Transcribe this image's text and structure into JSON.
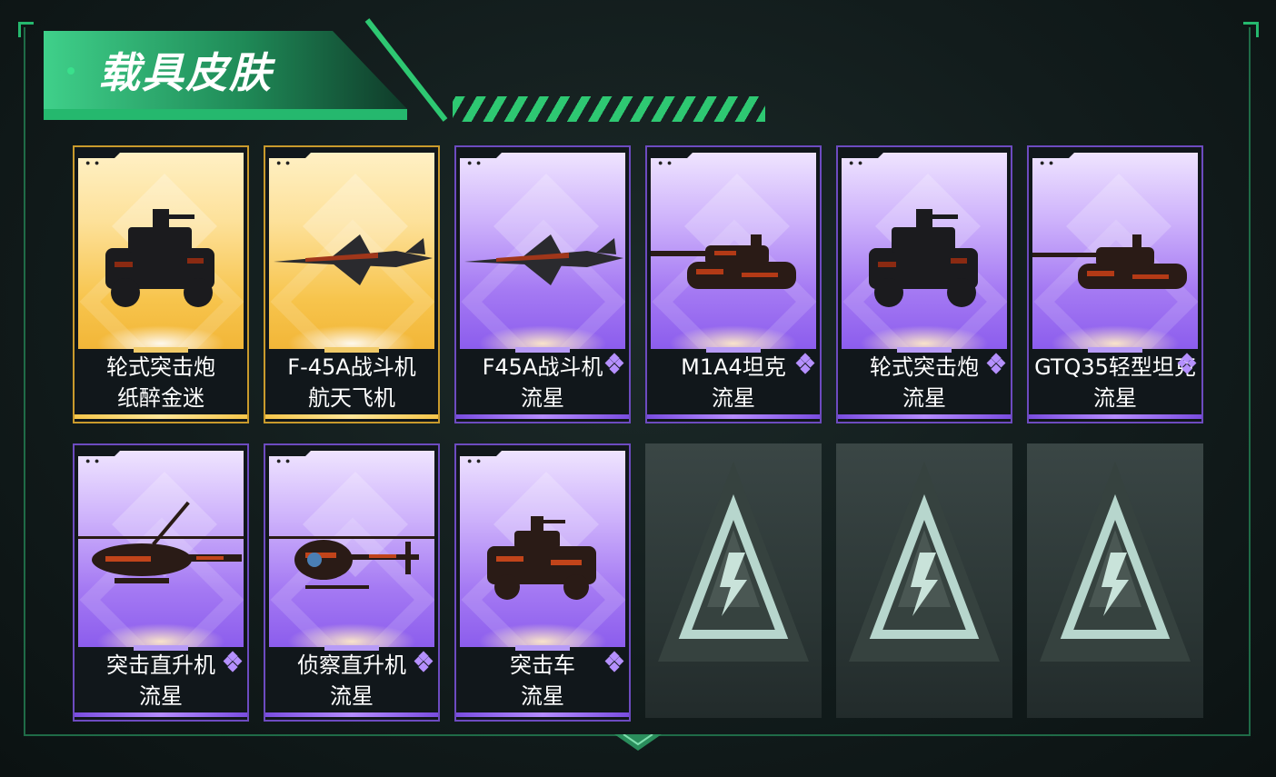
{
  "header": {
    "title": "载具皮肤"
  },
  "cards": [
    {
      "name": "轮式突击炮",
      "skin": "纸醉金迷",
      "rarity": "gold",
      "vehicle_icon": "armored-car-icon"
    },
    {
      "name": "F-45A战斗机",
      "skin": "航天飞机",
      "rarity": "gold",
      "vehicle_icon": "fighter-jet-icon"
    },
    {
      "name": "F45A战斗机",
      "skin": "流星",
      "rarity": "purple",
      "vehicle_icon": "fighter-jet-icon"
    },
    {
      "name": "M1A4坦克",
      "skin": "流星",
      "rarity": "purple",
      "vehicle_icon": "tank-icon"
    },
    {
      "name": "轮式突击炮",
      "skin": "流星",
      "rarity": "purple",
      "vehicle_icon": "armored-car-icon"
    },
    {
      "name": "GTQ35轻型坦克",
      "skin": "流星",
      "rarity": "purple",
      "vehicle_icon": "light-tank-icon"
    },
    {
      "name": "突击直升机",
      "skin": "流星",
      "rarity": "purple",
      "vehicle_icon": "attack-helicopter-icon"
    },
    {
      "name": "侦察直升机",
      "skin": "流星",
      "rarity": "purple",
      "vehicle_icon": "scout-helicopter-icon"
    },
    {
      "name": "突击车",
      "skin": "流星",
      "rarity": "purple",
      "vehicle_icon": "assault-vehicle-icon"
    }
  ],
  "empty_slots": 3,
  "colors": {
    "accent": "#2ec872",
    "gold": "#f6c64b",
    "purple": "#a57af3"
  }
}
